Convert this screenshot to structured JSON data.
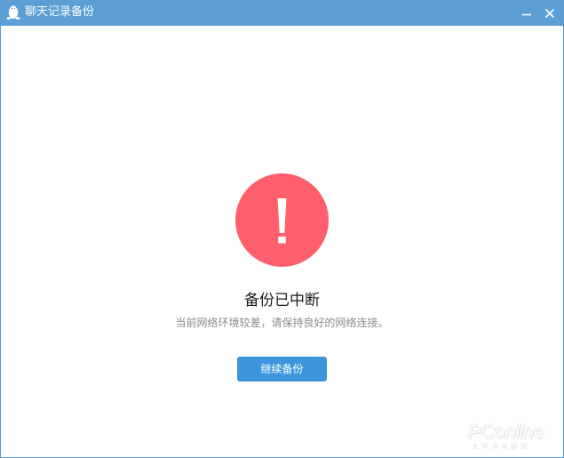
{
  "window": {
    "title": "聊天记录备份",
    "app_icon": "qq-penguin-icon",
    "controls": {
      "minimize_icon": "minimize-icon",
      "close_icon": "close-icon"
    }
  },
  "main": {
    "status_icon": "exclamation-icon",
    "heading": "备份已中断",
    "message": "当前网络环境较差，请保持良好的网络连接。",
    "continue_button_label": "继续备份"
  },
  "watermark": {
    "brand": "PConline",
    "tagline": "太平洋电脑网"
  },
  "colors": {
    "titlebar": "#5b9fd6",
    "alert": "#fe5f6d",
    "primary_button": "#3d96dd"
  }
}
